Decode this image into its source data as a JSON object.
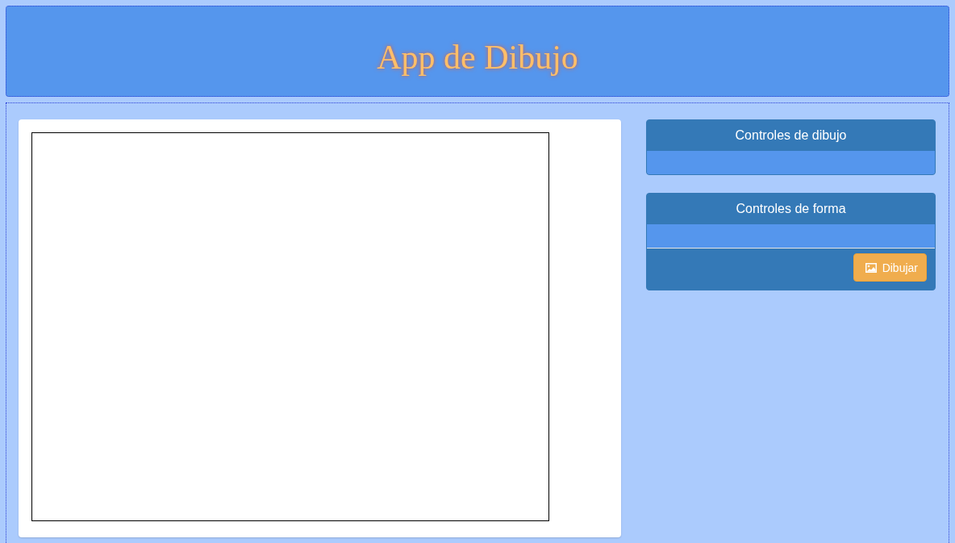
{
  "header": {
    "title": "App de Dibujo"
  },
  "panels": [
    {
      "title": "Controles de dibujo"
    },
    {
      "title": "Controles de forma",
      "button": {
        "label": "Dibujar"
      }
    }
  ]
}
